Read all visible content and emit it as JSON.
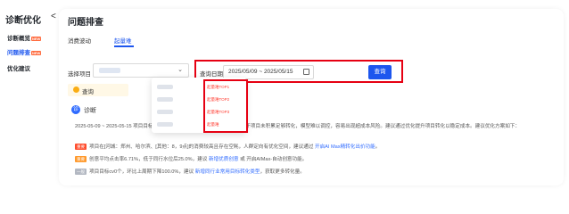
{
  "sidebar": {
    "title": "诊断优化",
    "collapse_glyph": "<",
    "items": [
      {
        "label": "诊断概览",
        "badge": "NEW",
        "active": false
      },
      {
        "label": "问题排查",
        "badge": "NEW",
        "active": true
      },
      {
        "label": "优化建议",
        "badge": "",
        "active": false
      }
    ]
  },
  "header": {
    "title": "问题排查"
  },
  "tabs": [
    {
      "label": "消费波动",
      "active": false
    },
    {
      "label": "起量难",
      "active": true
    }
  ],
  "filters": {
    "project_label": "选择项目",
    "date_label": "查询日期",
    "date_value": "2025/05/09 ~ 2025/05/15",
    "query_button": "查询"
  },
  "dropdown": {
    "tags": [
      "起量难TOP1",
      "起量难TOP2",
      "起量难TOP3",
      "起量难"
    ]
  },
  "notice": {
    "text": "查询"
  },
  "diagnosis": {
    "icon": "诊",
    "title": "诊断",
    "summary": "2025-05-09 ~ 2025-05-15 项目目标转化量为0，存在空耗情况，空耗消费下由于项目未积累足够转化，模型难以调控，容易出现超成本风险。建议通过优化提升项目转化以稳定成本。建议优化方案如下：",
    "items": [
      {
        "tag": "重要",
        "color": "red",
        "text": "项目在[河城：郑州、哈尔滨、[其他：8，9点]的消费较高且存在空耗，人群定向有优化空间，建议通过 ",
        "link": "开启AI Max精转化出价功能",
        "text2": "。"
      },
      {
        "tag": "重要",
        "color": "orange",
        "text": "创意平均点击率6.71%，低于同行水位后25.0%，建议 ",
        "link": "新增优质创意",
        "text2": " 或 开启AIMax-自动创意功能。"
      },
      {
        "tag": "一般",
        "color": "gray",
        "text": "项目目标cv0个，环比上周期下降100.0%，建议 ",
        "link": "新增同行业常用目标转化类型",
        "text2": "，获取更多转化量。"
      }
    ]
  }
}
